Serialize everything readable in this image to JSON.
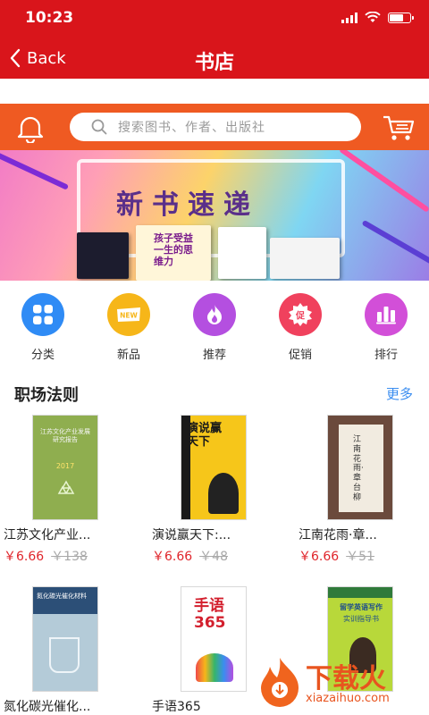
{
  "status": {
    "time": "10:23"
  },
  "nav": {
    "back_label": "Back",
    "title": "书店"
  },
  "search": {
    "placeholder": "搜索图书、作者、出版社"
  },
  "banner": {
    "title": "新书速递",
    "book_title": "孩子受益一生的思维力"
  },
  "categories": [
    {
      "label": "分类",
      "icon": "grid-icon",
      "color": "#2f8bf5"
    },
    {
      "label": "新品",
      "icon": "new-icon",
      "color": "#f6b619"
    },
    {
      "label": "推荐",
      "icon": "flame-icon",
      "color": "#b44fe0"
    },
    {
      "label": "促销",
      "icon": "promo-icon",
      "color": "#f0415d"
    },
    {
      "label": "排行",
      "icon": "ranking-icon",
      "color": "#d24fd8"
    }
  ],
  "section": {
    "title": "职场法则",
    "more": "更多"
  },
  "books": [
    {
      "title": "江苏文化产业...",
      "price": "￥6.66",
      "orig": "￥138"
    },
    {
      "title": "演说赢天下:...",
      "price": "￥6.66",
      "orig": "￥48"
    },
    {
      "title": "江南花雨·章...",
      "price": "￥6.66",
      "orig": "￥51"
    },
    {
      "title": "氮化碳光催化...",
      "price": "",
      "orig": ""
    },
    {
      "title": "手语365",
      "price": "",
      "orig": ""
    },
    {
      "title": "",
      "price": "",
      "orig": ""
    }
  ],
  "covers": [
    {
      "text": "江苏文化产业发展研究报告",
      "sub": "2017"
    },
    {
      "text": "演说赢天下",
      "sub": ""
    },
    {
      "text": "江南花雨·章台柳",
      "sub": ""
    },
    {
      "text": "氮化碳光催化材料",
      "sub": ""
    },
    {
      "text": "手语365",
      "sub": ""
    },
    {
      "text": "留学英语写作",
      "sub": "实训指导书"
    }
  ],
  "watermark": {
    "main": "下载火",
    "sub": "xiazaihuo.com"
  },
  "colors": {
    "primary": "#d9151b",
    "search_bar": "#ef5a22",
    "price": "#e0252b",
    "link": "#3a8df0"
  }
}
